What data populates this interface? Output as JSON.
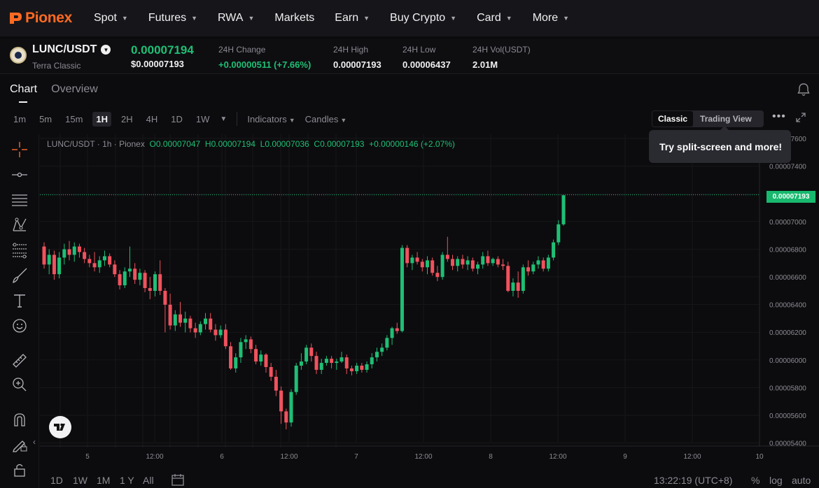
{
  "nav": {
    "brand": "Pionex",
    "items": [
      {
        "label": "Spot",
        "dropdown": true
      },
      {
        "label": "Futures",
        "dropdown": true
      },
      {
        "label": "RWA",
        "dropdown": true
      },
      {
        "label": "Markets",
        "dropdown": false
      },
      {
        "label": "Earn",
        "dropdown": true
      },
      {
        "label": "Buy Crypto",
        "dropdown": true
      },
      {
        "label": "Card",
        "dropdown": true
      },
      {
        "label": "More",
        "dropdown": true
      }
    ]
  },
  "ticker": {
    "pair": "LUNC/USDT",
    "name": "Terra Classic",
    "price": "0.00007194",
    "price_usd": "$0.00007193",
    "change_label": "24H Change",
    "change_value": "+0.00000511 (+7.66%)",
    "high_label": "24H High",
    "high_value": "0.00007193",
    "low_label": "24H Low",
    "low_value": "0.00006437",
    "vol_label": "24H Vol(USDT)",
    "vol_value": "2.01M",
    "colors": {
      "up": "#1fbf75",
      "down": "#f0525e"
    }
  },
  "tabs": {
    "chart": "Chart",
    "overview": "Overview"
  },
  "toolbar": {
    "timeframes": [
      "1m",
      "5m",
      "15m",
      "1H",
      "2H",
      "4H",
      "1D",
      "1W"
    ],
    "active_timeframe": "1H",
    "indicators": "Indicators",
    "candles": "Candles",
    "classic": "Classic",
    "trading_view": "Trading View",
    "tooltip": "Try split-screen and more!"
  },
  "legend": {
    "symbol": "LUNC/USDT · 1h · Pionex",
    "o": "O0.00007047",
    "h": "H0.00007194",
    "l": "L0.00007036",
    "c": "C0.00007193",
    "chg": "+0.00000146 (+2.07%)"
  },
  "chart_data": {
    "type": "candlestick",
    "y_ticks": [
      "0.00007600",
      "0.00007400",
      "0.00007200",
      "0.00007000",
      "0.00006800",
      "0.00006600",
      "0.00006400",
      "0.00006200",
      "0.00006000",
      "0.00005800",
      "0.00005600",
      "0.00005400"
    ],
    "x_ticks": [
      "5",
      "12:00",
      "6",
      "12:00",
      "7",
      "12:00",
      "8",
      "12:00",
      "9",
      "12:00",
      "10"
    ],
    "last_price": "0.00007193",
    "ylim": [
      5.4e-05,
      7.6e-05
    ],
    "candles": [
      [
        68.2,
        68.5,
        66.6,
        66.9
      ],
      [
        66.9,
        68.0,
        66.2,
        67.6
      ],
      [
        67.6,
        67.9,
        65.8,
        66.2
      ],
      [
        66.2,
        67.8,
        65.9,
        67.4
      ],
      [
        67.4,
        68.4,
        66.9,
        68.0
      ],
      [
        68.0,
        68.6,
        67.2,
        67.6
      ],
      [
        67.6,
        68.5,
        67.1,
        68.2
      ],
      [
        68.2,
        68.4,
        67.4,
        67.8
      ],
      [
        67.8,
        68.1,
        67.0,
        67.3
      ],
      [
        67.3,
        67.6,
        66.7,
        67.0
      ],
      [
        67.0,
        67.8,
        66.4,
        66.7
      ],
      [
        66.7,
        67.5,
        66.3,
        67.2
      ],
      [
        67.2,
        67.9,
        66.8,
        67.5
      ],
      [
        67.5,
        67.7,
        66.7,
        66.9
      ],
      [
        66.9,
        67.2,
        66.0,
        66.2
      ],
      [
        66.2,
        66.5,
        65.1,
        65.4
      ],
      [
        65.4,
        66.7,
        65.2,
        66.4
      ],
      [
        66.4,
        68.2,
        66.0,
        66.6
      ],
      [
        66.6,
        67.0,
        65.5,
        65.8
      ],
      [
        65.8,
        66.6,
        65.4,
        66.3
      ],
      [
        66.3,
        66.5,
        64.9,
        65.2
      ],
      [
        65.2,
        66.0,
        64.4,
        65.0
      ],
      [
        65.0,
        66.4,
        64.6,
        66.2
      ],
      [
        66.2,
        67.2,
        64.7,
        65.0
      ],
      [
        65.0,
        65.2,
        62.0,
        64.0
      ],
      [
        64.0,
        64.8,
        62.2,
        62.5
      ],
      [
        62.5,
        63.6,
        62.1,
        63.3
      ],
      [
        63.3,
        64.2,
        62.4,
        62.7
      ],
      [
        62.7,
        63.5,
        62.0,
        63.0
      ],
      [
        63.0,
        63.2,
        62.0,
        62.3
      ],
      [
        62.3,
        62.7,
        61.6,
        62.0
      ],
      [
        62.0,
        62.8,
        61.8,
        62.6
      ],
      [
        62.6,
        63.4,
        62.2,
        63.0
      ],
      [
        63.0,
        63.4,
        62.0,
        62.2
      ],
      [
        62.2,
        62.6,
        61.4,
        61.8
      ],
      [
        61.8,
        62.5,
        61.6,
        62.2
      ],
      [
        62.2,
        62.6,
        60.8,
        61.0
      ],
      [
        61.0,
        61.3,
        59.3,
        59.4
      ],
      [
        59.4,
        60.5,
        59.1,
        60.2
      ],
      [
        60.2,
        61.6,
        59.8,
        61.3
      ],
      [
        61.3,
        61.8,
        60.8,
        61.5
      ],
      [
        61.5,
        61.7,
        60.5,
        60.8
      ],
      [
        60.8,
        61.1,
        59.7,
        59.9
      ],
      [
        59.9,
        60.7,
        59.6,
        60.4
      ],
      [
        60.4,
        60.5,
        59.1,
        59.5
      ],
      [
        59.5,
        59.8,
        58.5,
        58.8
      ],
      [
        58.8,
        59.3,
        57.4,
        57.8
      ],
      [
        57.8,
        58.1,
        55.4,
        56.3
      ],
      [
        56.3,
        56.5,
        55.0,
        55.5
      ],
      [
        55.5,
        57.9,
        55.2,
        57.7
      ],
      [
        57.7,
        59.8,
        57.5,
        59.6
      ],
      [
        59.6,
        60.5,
        59.3,
        59.9
      ],
      [
        59.9,
        61.1,
        59.7,
        60.9
      ],
      [
        60.9,
        61.2,
        59.9,
        60.3
      ],
      [
        60.3,
        60.6,
        59.0,
        59.3
      ],
      [
        59.3,
        60.1,
        59.0,
        59.8
      ],
      [
        59.8,
        60.3,
        59.6,
        60.1
      ],
      [
        60.1,
        60.3,
        59.4,
        59.8
      ],
      [
        59.8,
        60.1,
        59.3,
        59.9
      ],
      [
        59.9,
        60.6,
        59.8,
        60.2
      ],
      [
        60.2,
        60.4,
        59.0,
        59.4
      ],
      [
        59.4,
        59.6,
        58.9,
        59.2
      ],
      [
        59.2,
        59.8,
        59.0,
        59.6
      ],
      [
        59.6,
        59.8,
        59.1,
        59.3
      ],
      [
        59.3,
        59.9,
        59.1,
        59.7
      ],
      [
        59.7,
        60.5,
        59.4,
        60.2
      ],
      [
        60.2,
        60.9,
        59.9,
        60.6
      ],
      [
        60.6,
        61.2,
        60.3,
        60.9
      ],
      [
        60.9,
        61.8,
        60.7,
        61.6
      ],
      [
        61.6,
        62.4,
        61.1,
        62.3
      ],
      [
        62.3,
        62.7,
        61.9,
        62.1
      ],
      [
        62.1,
        68.3,
        62.0,
        68.1
      ],
      [
        68.1,
        68.3,
        66.7,
        67.0
      ],
      [
        67.0,
        67.6,
        66.5,
        67.4
      ],
      [
        67.4,
        67.8,
        66.9,
        67.1
      ],
      [
        67.1,
        67.3,
        66.4,
        66.7
      ],
      [
        66.7,
        67.5,
        66.2,
        67.2
      ],
      [
        67.2,
        67.4,
        66.1,
        66.3
      ],
      [
        66.3,
        66.8,
        65.7,
        66.0
      ],
      [
        66.0,
        67.8,
        65.8,
        67.6
      ],
      [
        67.6,
        68.9,
        67.1,
        67.3
      ],
      [
        67.3,
        67.6,
        66.5,
        66.8
      ],
      [
        66.8,
        67.5,
        66.4,
        67.3
      ],
      [
        67.3,
        67.6,
        66.6,
        66.9
      ],
      [
        66.9,
        67.5,
        66.5,
        67.2
      ],
      [
        67.2,
        67.4,
        66.4,
        66.6
      ],
      [
        66.6,
        67.1,
        66.2,
        66.9
      ],
      [
        66.9,
        67.8,
        66.6,
        67.5
      ],
      [
        67.5,
        67.9,
        66.8,
        67.0
      ],
      [
        67.0,
        67.4,
        66.8,
        67.3
      ],
      [
        67.3,
        67.5,
        66.7,
        66.9
      ],
      [
        66.9,
        67.3,
        66.5,
        66.8
      ],
      [
        66.8,
        67.1,
        64.9,
        65.0
      ],
      [
        65.0,
        65.9,
        64.6,
        65.6
      ],
      [
        65.6,
        66.4,
        64.5,
        65.0
      ],
      [
        65.0,
        66.9,
        64.8,
        66.7
      ],
      [
        66.7,
        67.2,
        66.1,
        66.4
      ],
      [
        66.4,
        67.1,
        66.2,
        66.9
      ],
      [
        66.9,
        67.5,
        66.6,
        67.2
      ],
      [
        67.2,
        67.4,
        66.4,
        66.6
      ],
      [
        66.6,
        67.6,
        66.4,
        67.4
      ],
      [
        67.4,
        68.7,
        67.2,
        68.5
      ],
      [
        68.5,
        70.1,
        68.3,
        69.8
      ],
      [
        69.8,
        71.9,
        69.7,
        71.9
      ]
    ]
  },
  "bottom": {
    "ranges": [
      "1D",
      "1W",
      "1M",
      "1 Y",
      "All"
    ],
    "time": "13:22:19 (UTC+8)",
    "percent": "%",
    "log": "log",
    "auto": "auto"
  }
}
